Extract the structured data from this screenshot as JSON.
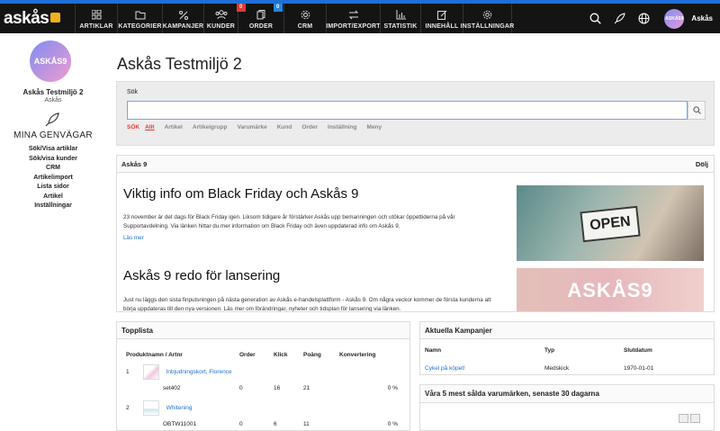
{
  "app": {
    "logo_text": "askås"
  },
  "nav": {
    "items": [
      {
        "label": "ARTIKLAR",
        "badge": ""
      },
      {
        "label": "KATEGORIER",
        "badge": ""
      },
      {
        "label": "KAMPANJER",
        "badge": ""
      },
      {
        "label": "KUNDER",
        "badge": ""
      },
      {
        "label": "ORDER",
        "badge": "0"
      },
      {
        "label": "CRM",
        "badge": "0"
      },
      {
        "label": "IMPORT/EXPORT",
        "badge": ""
      },
      {
        "label": "STATISTIK",
        "badge": ""
      },
      {
        "label": "INNEHÅLL",
        "badge": ""
      },
      {
        "label": "INSTÄLLNINGAR",
        "badge": ""
      }
    ],
    "user_name": "Askås",
    "avatar_text": "ASKÅS9"
  },
  "sidebar": {
    "avatar_text": "ASKÅS9",
    "shop_name": "Askås Testmiljö 2",
    "shop_sub": "Askås",
    "shortcuts_title": "MINA GENVÄGAR",
    "links": [
      "Sök/Visa artiklar",
      "Sök/visa kunder",
      "CRM",
      "Artikelimport",
      "Lista sidor",
      "Artikel",
      "Inställningar"
    ]
  },
  "page": {
    "title": "Askås Testmiljö 2"
  },
  "search": {
    "label": "Sök",
    "placeholder": "",
    "prefix": "SÖK",
    "filters": [
      "Allt",
      "Artikel",
      "Artikelgrupp",
      "Varumärke",
      "Kund",
      "Order",
      "Inställning",
      "Meny"
    ]
  },
  "news": {
    "header": "Askås 9",
    "hide_label": "Dölj",
    "articles": [
      {
        "title": "Viktig info om Black Friday och Askås 9",
        "body": "23 november är det dags för Black Friday igen. Liksom tidigare år förstärker Askås upp bemanningen och utökar öppettiderna på vår Supportavdelning. Via länken hittar du mer information om Black Friday och även uppdaterad info om Askås 9.",
        "more": "Läs mer"
      },
      {
        "title": "Askås 9 redo för lansering",
        "body": "Just nu läggs den sista finputsningen på nästa generation av Askås e-handelsplattform - Askås 9. Om några veckor kommer de första kunderna att börja uppdateras till den nya versionen. Läs mer om förändringar, nyheter och tidsplan för lansering via länken."
      }
    ],
    "image1_text": "OPEN",
    "image2_text": "ASKÅS9"
  },
  "toplist": {
    "title": "Topplista",
    "headers": [
      "Produktnamn / Artnr",
      "Order",
      "Klick",
      "Poäng",
      "Konvertering"
    ],
    "rows": [
      {
        "rank": "1",
        "name": "Inbjudningskort, Florence",
        "artnr": "set402",
        "order": "0",
        "click": "16",
        "points": "21",
        "conv": "0 %"
      },
      {
        "rank": "2",
        "name": "Whitening",
        "artnr": "OBTW11001",
        "order": "0",
        "click": "6",
        "points": "11",
        "conv": "0 %"
      }
    ]
  },
  "campaigns": {
    "title": "Aktuella Kampanjer",
    "headers": [
      "Namn",
      "Typ",
      "Slutdatum"
    ],
    "rows": [
      {
        "name": "Cykel på köpet!",
        "type": "Medskick",
        "end": "1970-01-01"
      }
    ]
  },
  "brands": {
    "title": "Våra 5 mest sålda varumärken, senaste 30 dagarna"
  }
}
